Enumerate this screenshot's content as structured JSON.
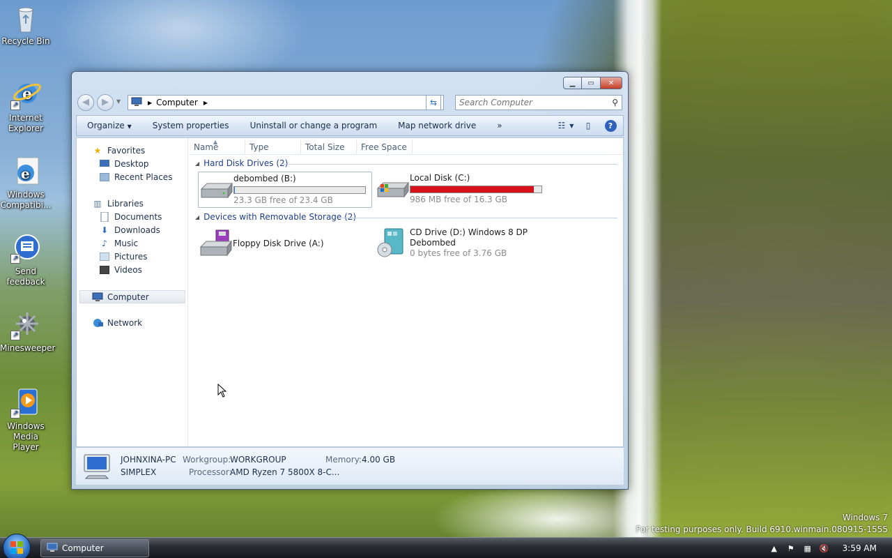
{
  "desktop": {
    "icons": [
      {
        "label": "Recycle Bin",
        "icon": "recycle-bin-icon"
      },
      {
        "label": "Internet\nExplorer",
        "icon": "internet-explorer-icon"
      },
      {
        "label": "Windows\nCompatibi...",
        "icon": "windows-compatibility-icon"
      },
      {
        "label": "Send\nfeedback",
        "icon": "send-feedback-icon"
      },
      {
        "label": "Minesweeper",
        "icon": "minesweeper-icon"
      },
      {
        "label": "Windows\nMedia Player",
        "icon": "media-player-icon"
      }
    ],
    "watermark_line1": "Windows 7",
    "watermark_line2": "For testing purposes only. Build 6910.winmain.080915-1555"
  },
  "window": {
    "address": {
      "root_icon": "computer-icon",
      "segment": "Computer"
    },
    "search_placeholder": "Search Computer",
    "toolbar": {
      "organize": "Organize",
      "system_properties": "System properties",
      "uninstall": "Uninstall or change a program",
      "map_drive": "Map network drive",
      "more": "»"
    },
    "nav": {
      "favorites": "Favorites",
      "desktop": "Desktop",
      "recent_places": "Recent Places",
      "libraries": "Libraries",
      "documents": "Documents",
      "downloads": "Downloads",
      "music": "Music",
      "pictures": "Pictures",
      "videos": "Videos",
      "computer": "Computer",
      "network": "Network"
    },
    "columns": [
      "Name",
      "Type",
      "Total Size",
      "Free Space"
    ],
    "groups": {
      "hdd": "Hard Disk Drives (2)",
      "removable": "Devices with Removable Storage (2)"
    },
    "drives": {
      "b": {
        "name": "debombed (B:)",
        "sub": "23.3 GB free of 23.4 GB",
        "used_fraction": 0.004,
        "bar_color": "#2f7bd6"
      },
      "c": {
        "name": "Local Disk (C:)",
        "sub": "986 MB free of 16.3 GB",
        "used_fraction": 0.94,
        "bar_color": "#d8101a"
      },
      "a": {
        "name": "Floppy Disk Drive (A:)"
      },
      "d": {
        "name": "CD Drive (D:) Windows 8 DP",
        "name2": "Debombed",
        "sub": "0 bytes free of 3.76 GB"
      }
    },
    "details": {
      "pc_name": "JOHNXINA-PC",
      "pc_name2": "SIMPLEX",
      "workgroup_label": "Workgroup:",
      "workgroup": "WORKGROUP",
      "memory_label": "Memory:",
      "memory": "4.00 GB",
      "processor_label": "Processor:",
      "processor": "AMD Ryzen 7 5800X 8-C..."
    }
  },
  "taskbar": {
    "task_label": "Computer",
    "clock": "3:59 AM"
  }
}
